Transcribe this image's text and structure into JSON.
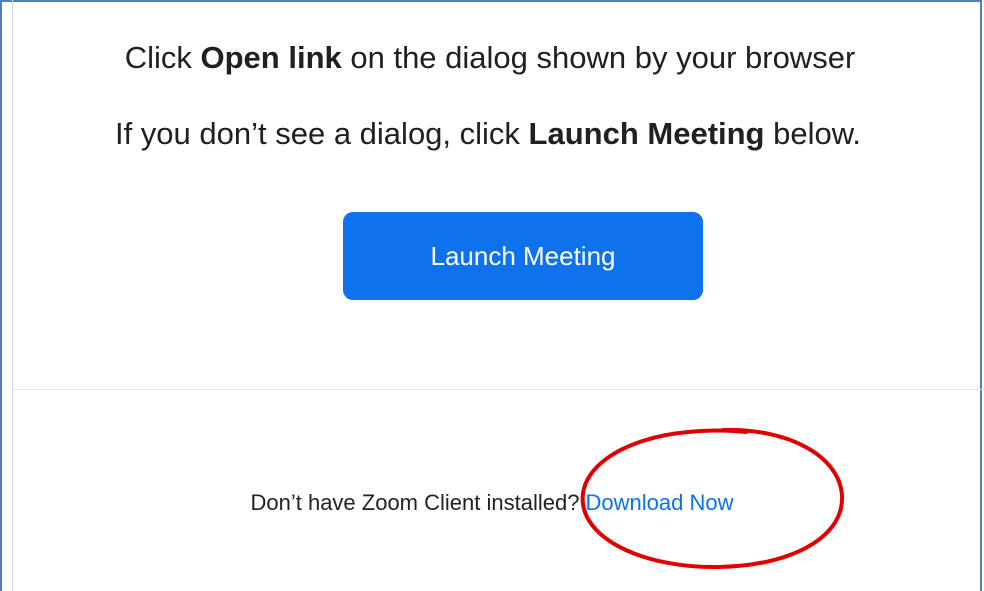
{
  "prompt": {
    "line1_pre": "Click ",
    "line1_bold": "Open link",
    "line1_post": " on the dialog shown by your browser",
    "line2_pre": "If you don’t see a dialog, click ",
    "line2_bold": "Launch Meeting",
    "line2_post": " below."
  },
  "launch_button": {
    "label": "Launch Meeting",
    "color": "#0e72ed"
  },
  "footer": {
    "question": "Don’t have Zoom Client installed? ",
    "download_link": "Download Now",
    "link_color": "#0e72ed"
  },
  "annotation": {
    "shape": "red-circle-highlight",
    "color": "#e00000"
  }
}
